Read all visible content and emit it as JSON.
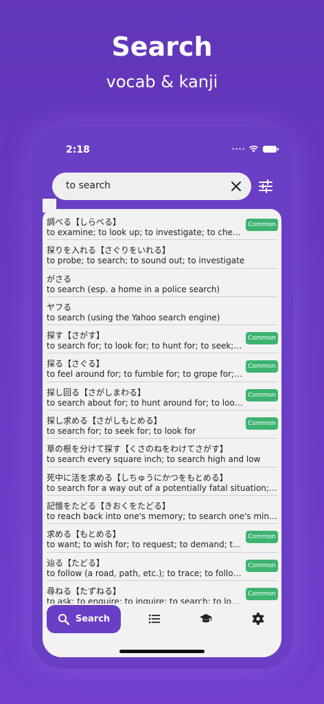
{
  "hero": {
    "title": "Search",
    "subtitle": "vocab & kanji"
  },
  "status": {
    "time": "2:18"
  },
  "search": {
    "value": "to search"
  },
  "badge_label": "Common",
  "results": [
    {
      "word": "調べる【しらべる】",
      "meaning": "to examine; to look up; to investigate; to check up; to survey",
      "common": true
    },
    {
      "word": "探りを入れる【さぐりをいれる】",
      "meaning": "to probe; to search; to sound out; to investigate",
      "common": false
    },
    {
      "word": "がさる",
      "meaning": "to search (esp. a home in a police search)",
      "common": false
    },
    {
      "word": "ヤフる",
      "meaning": "to search (using the Yahoo search engine)",
      "common": false
    },
    {
      "word": "探す【さがす】",
      "meaning": "to search for; to look for; to hunt for; to seek; to search",
      "common": true
    },
    {
      "word": "探る【さぐる】",
      "meaning": "to feel around for; to fumble for; to grope for; to search",
      "common": true
    },
    {
      "word": "探し回る【さがしまわる】",
      "meaning": "to search about for; to hunt around for; to look high and low",
      "common": true
    },
    {
      "word": "探し求める【さがしもとめる】",
      "meaning": "to search for; to seek for; to look for",
      "common": true
    },
    {
      "word": "草の根を分けて探す【くさのねをわけてさがす】",
      "meaning": "to search every square inch; to search high and low",
      "common": false
    },
    {
      "word": "死中に活を求める【しちゅうにかつをもとめる】",
      "meaning": "to search for a way out of a potentially fatal situation; to seek",
      "common": false
    },
    {
      "word": "記憶をたどる【きおくをたどる】",
      "meaning": "to reach back into one's memory; to search one's mind; to recall",
      "common": false
    },
    {
      "word": "求める【もとめる】",
      "meaning": "to want; to wish for; to request; to demand; to require",
      "common": true
    },
    {
      "word": "辿る【たどる】",
      "meaning": "to follow (a road, path, etc.); to trace; to follow (a course)",
      "common": true
    },
    {
      "word": "尋ねる【たずねる】",
      "meaning": "to ask; to enquire; to inquire; to search; to look for",
      "common": true
    }
  ],
  "tabs": {
    "search_label": "Search"
  },
  "colors": {
    "accent": "#6a3ec5",
    "badge": "#3cb371",
    "background": "#6236b7"
  }
}
